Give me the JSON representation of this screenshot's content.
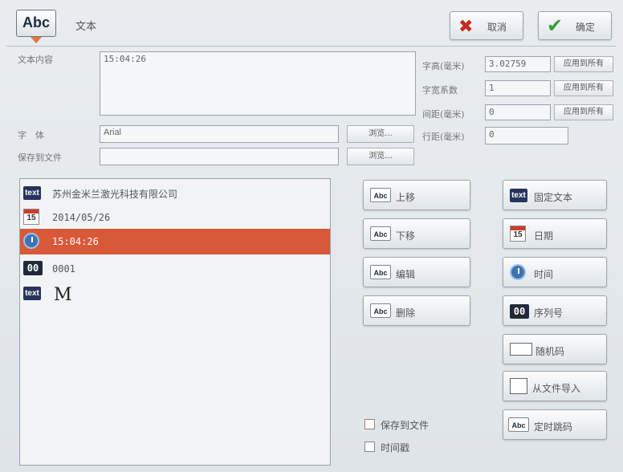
{
  "title": {
    "logo": "Abc",
    "text": "文本"
  },
  "actions": {
    "cancel": "取消",
    "confirm": "确定"
  },
  "form": {
    "content_label": "文本内容",
    "content_value": "15:04:26",
    "font_label": "字　体",
    "font_value": "Arial",
    "save_file_label": "保存到文件",
    "save_file_value": "",
    "browse": "浏览...",
    "char_height_label": "字高(毫米)",
    "char_height_value": "3.02759",
    "char_width_label": "字宽系数",
    "char_width_value": "1",
    "spacing_label": "间距(毫米)",
    "spacing_value": "0",
    "line_spacing_label": "行距(毫米)",
    "line_spacing_value": "0",
    "apply_all": "应用到所有"
  },
  "list": {
    "items": [
      {
        "icon": "text",
        "label": "苏州金米兰激光科技有限公司"
      },
      {
        "icon": "15",
        "label": "2014/05/26"
      },
      {
        "icon": "clock",
        "label": "15:04:26"
      },
      {
        "icon": "00",
        "label": "0001"
      },
      {
        "icon": "text",
        "label": "M"
      }
    ]
  },
  "middle_buttons": {
    "up": "上移",
    "down": "下移",
    "edit": "编辑",
    "delete": "删除"
  },
  "right_buttons": {
    "fixed_text": "固定文本",
    "date": "日期",
    "time": "时间",
    "serial": "序列号",
    "random": "随机码",
    "import": "从文件导入",
    "timed_jump": "定时跳码",
    "text_icon": "text",
    "cal_icon": "15",
    "seq_icon": "00"
  },
  "checks": {
    "save_to_file": "保存到文件",
    "timestamp": "时间戳"
  }
}
